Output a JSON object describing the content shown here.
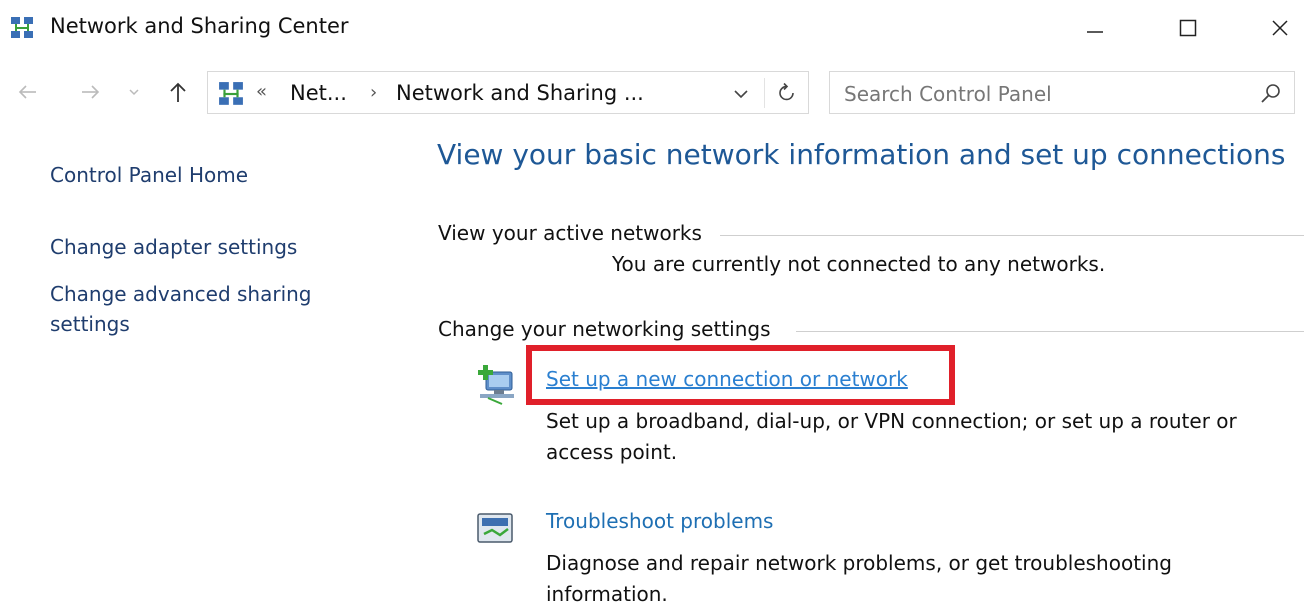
{
  "window": {
    "title": "Network and Sharing Center",
    "icon": "network-sharing-icon",
    "controls": [
      "minimize-icon",
      "maximize-icon",
      "close-icon"
    ]
  },
  "navigation": {
    "back": "arrow-left-icon",
    "forward": "arrow-right-icon",
    "recent": "chevron-down-icon",
    "up": "arrow-up-icon"
  },
  "address_bar": {
    "overflow": "«",
    "crumbs": [
      "Net...",
      "Network and Sharing ..."
    ],
    "separator": "›",
    "dropdown": "chevron-down-icon",
    "refresh": "refresh-icon"
  },
  "search": {
    "placeholder": "Search Control Panel",
    "value": "",
    "icon": "search-icon"
  },
  "sidebar": {
    "home": "Control Panel Home",
    "adapter": "Change adapter settings",
    "advanced_line1": "Change advanced sharing",
    "advanced_line2": "settings"
  },
  "main": {
    "heading": "View your basic network information and set up connections",
    "active_networks_label": "View your active networks",
    "active_networks_message": "You are currently not connected to any networks.",
    "change_settings_label": "Change your networking settings",
    "tasks": [
      {
        "link": "Set up a new connection or network",
        "description": "Set up a broadband, dial-up, or VPN connection; or set up a router or access point.",
        "icon": "new-connection-icon",
        "highlighted": true
      },
      {
        "link": "Troubleshoot problems",
        "description": "Diagnose and repair network problems, or get troubleshooting information.",
        "icon": "troubleshoot-icon",
        "highlighted": false
      }
    ]
  },
  "colors": {
    "heading": "#1e5896",
    "link": "#1e6fb3",
    "highlight": "#e0202a"
  }
}
